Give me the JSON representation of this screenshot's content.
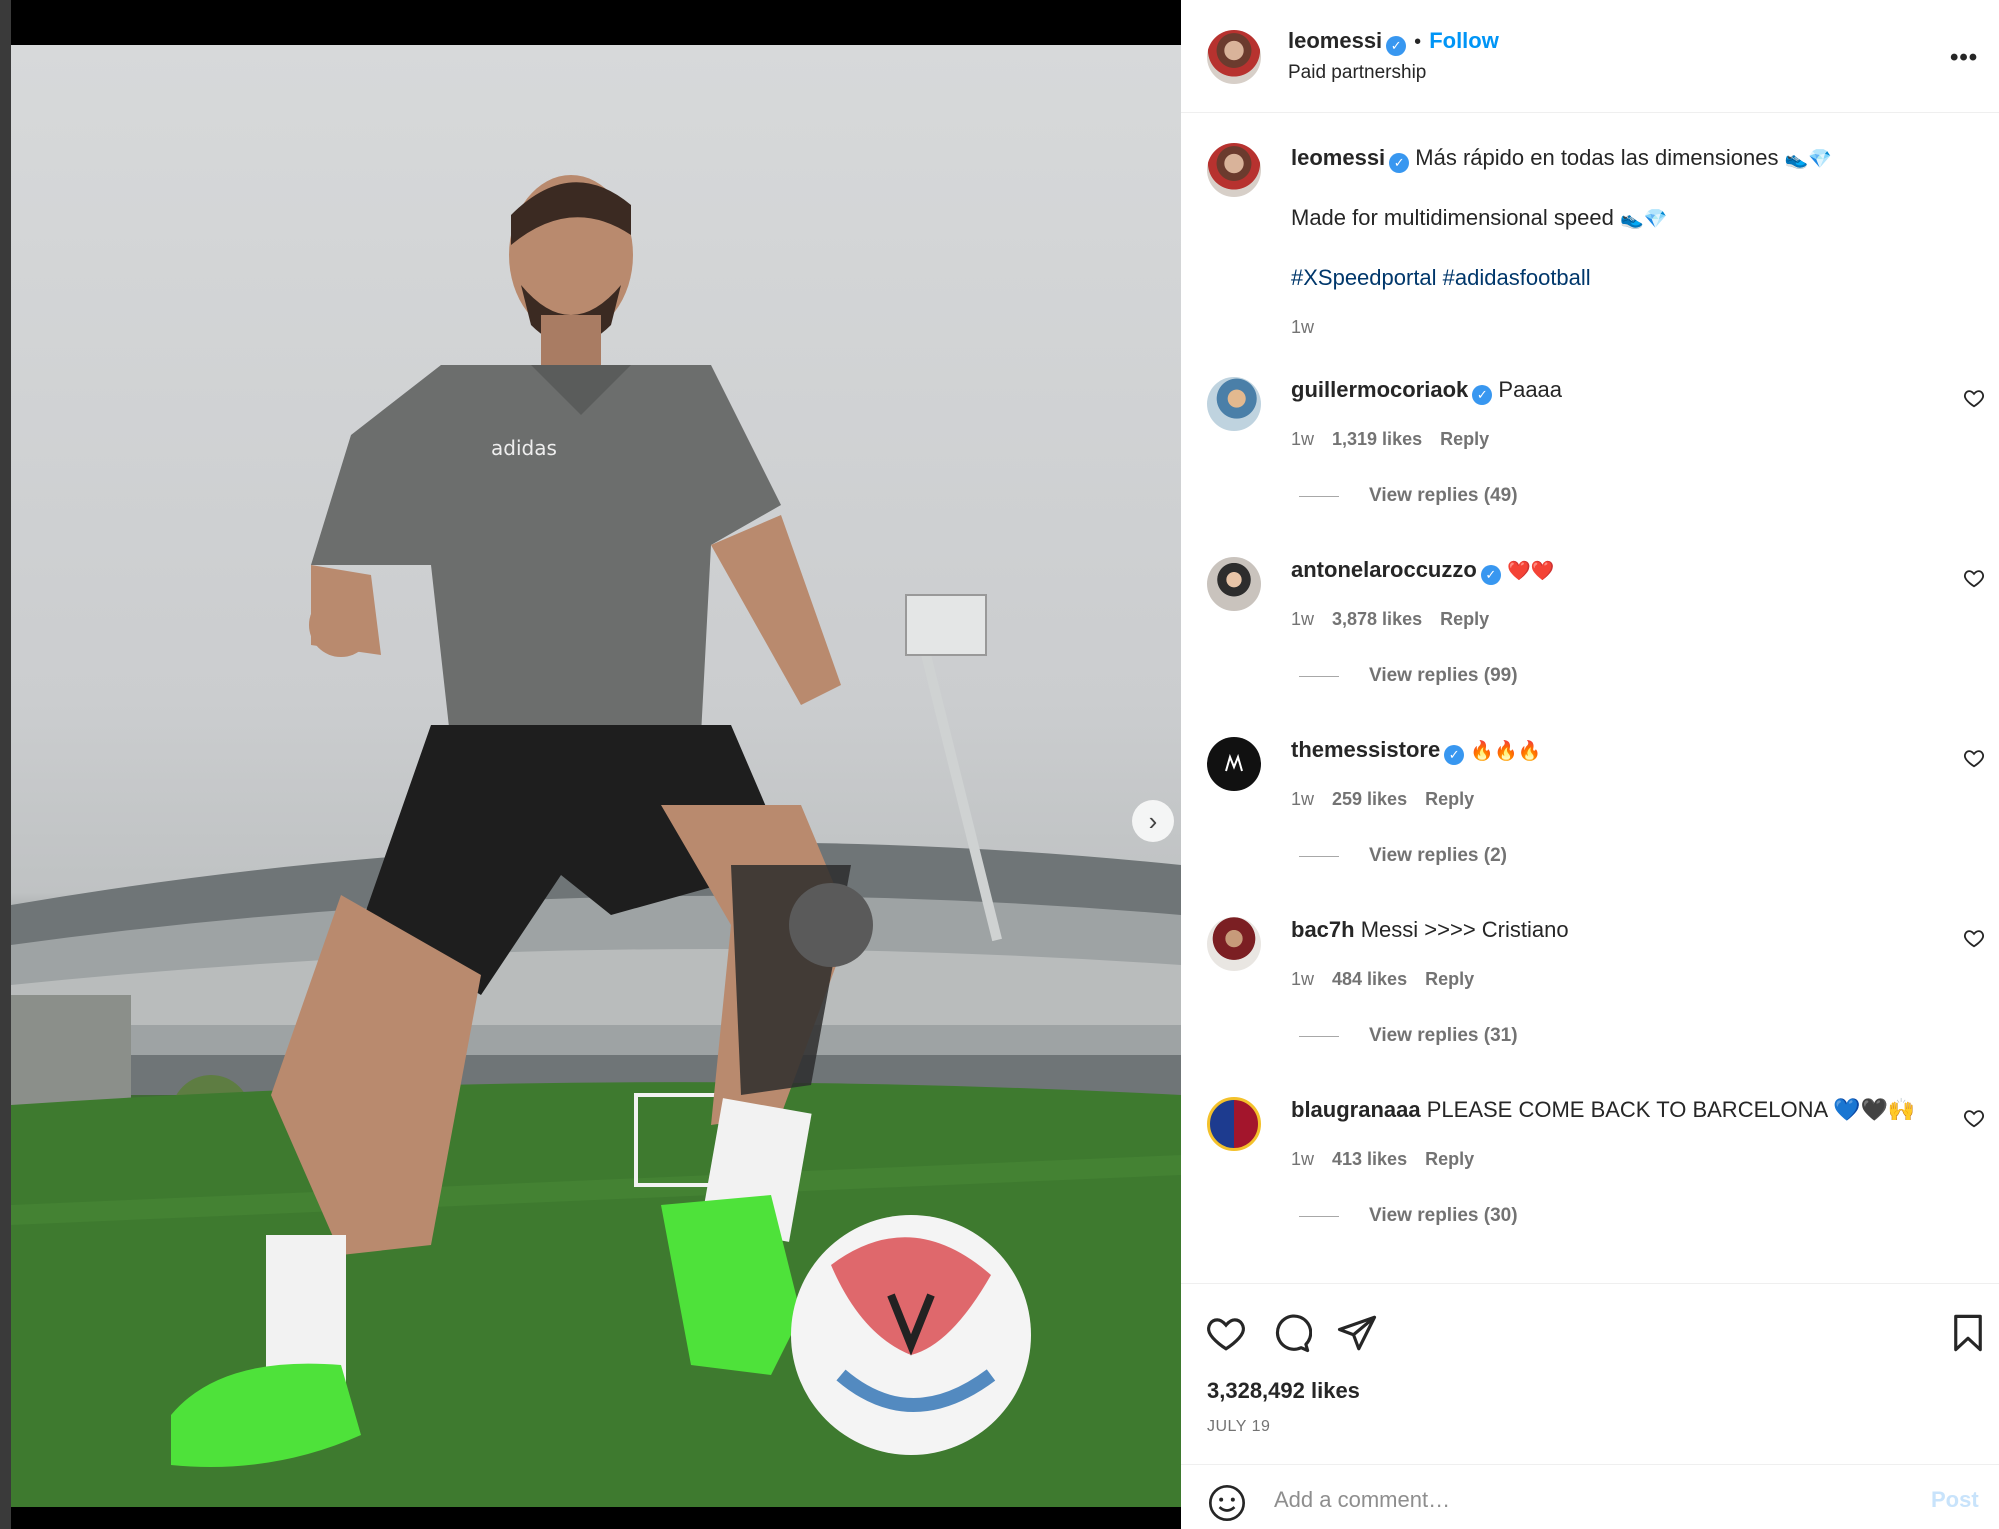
{
  "post": {
    "username": "leomessi",
    "verified_icon": "verified-badge-icon",
    "separator": "•",
    "follow_label": "Follow",
    "subtitle": "Paid partnership",
    "more_icon": "more-options-icon",
    "more_glyph": "•••"
  },
  "caption": {
    "username": "leomessi",
    "line1": "Más rápido en todas las dimensiones",
    "line1_emoji": "👟💎",
    "line2": "Made for multidimensional speed",
    "line2_emoji": "👟💎",
    "hashtags": "#XSpeedportal #adidasfootball",
    "time": "1w"
  },
  "comments": [
    {
      "username": "guillermocoriaok",
      "verified": true,
      "text": "Paaaa",
      "time": "1w",
      "likes": "1,319 likes",
      "reply": "Reply",
      "view_replies": "View replies (49)"
    },
    {
      "username": "antonelaroccuzzo",
      "verified": true,
      "text": "❤️❤️",
      "time": "1w",
      "likes": "3,878 likes",
      "reply": "Reply",
      "view_replies": "View replies (99)"
    },
    {
      "username": "themessistore",
      "verified": true,
      "text": "🔥🔥🔥",
      "time": "1w",
      "likes": "259 likes",
      "reply": "Reply",
      "view_replies": "View replies (2)"
    },
    {
      "username": "bac7h",
      "verified": false,
      "text": "Messi >>>> Cristiano",
      "time": "1w",
      "likes": "484 likes",
      "reply": "Reply",
      "view_replies": "View replies (31)"
    },
    {
      "username": "blaugranaaa",
      "verified": false,
      "text": "PLEASE COME BACK TO BARCELONA 💙🖤🙌",
      "time": "1w",
      "likes": "413 likes",
      "reply": "Reply",
      "view_replies": "View replies (30)"
    }
  ],
  "actions": {
    "like_icon": "heart-icon",
    "comment_icon": "comment-bubble-icon",
    "share_icon": "send-icon",
    "save_icon": "bookmark-icon",
    "likes": "3,328,492 likes",
    "date": "JULY 19"
  },
  "comment_box": {
    "emoji_icon": "smiley-icon",
    "placeholder": "Add a comment…",
    "post_label": "Post"
  },
  "media": {
    "next_glyph": "›",
    "carousel_total": 2,
    "carousel_active": 1
  },
  "colors": {
    "link_blue": "#0095f6",
    "hashtag_blue": "#00376b",
    "muted_text": "#737373",
    "boot_green": "#4ee23a"
  }
}
